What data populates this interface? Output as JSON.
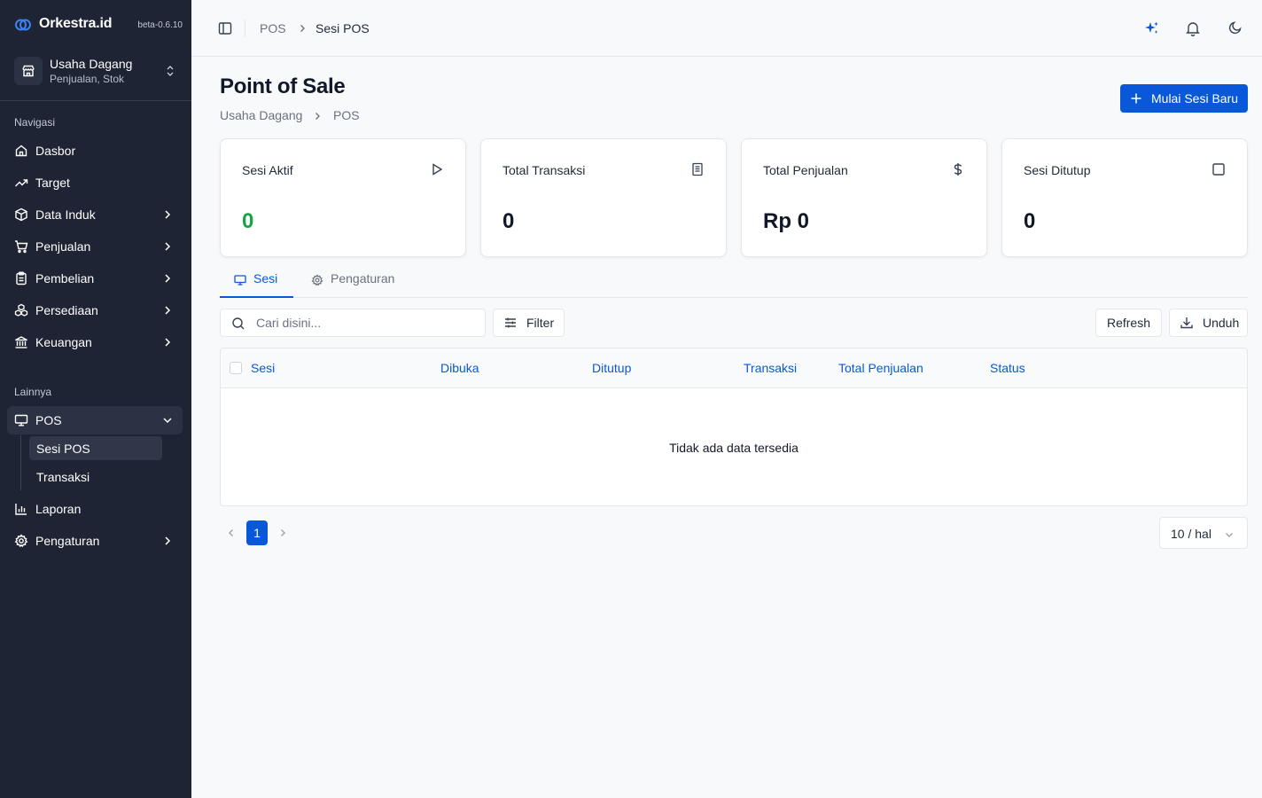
{
  "brand": {
    "name": "Orkestra.id",
    "version": "beta-0.6.10"
  },
  "org": {
    "name": "Usaha Dagang",
    "subtitle": "Penjualan, Stok"
  },
  "sidebar": {
    "section_main": "Navigasi",
    "section_other": "Lainnya",
    "items": [
      {
        "label": "Dasbor",
        "icon": "home-icon"
      },
      {
        "label": "Target",
        "icon": "trend-icon"
      },
      {
        "label": "Data Induk",
        "icon": "box-icon"
      },
      {
        "label": "Penjualan",
        "icon": "cart-icon"
      },
      {
        "label": "Pembelian",
        "icon": "clipboard-icon"
      },
      {
        "label": "Persediaan",
        "icon": "boxes-icon"
      },
      {
        "label": "Keuangan",
        "icon": "bank-icon"
      }
    ],
    "pos": {
      "label": "POS",
      "icon": "monitor-icon",
      "children": [
        "Sesi POS",
        "Transaksi"
      ]
    },
    "laporan": "Laporan",
    "pengaturan": "Pengaturan"
  },
  "topbar": {
    "crumbs": [
      "POS",
      "Sesi POS"
    ]
  },
  "header": {
    "title": "Point of Sale",
    "crumbs": [
      "Usaha Dagang",
      "POS"
    ],
    "primary_button": "Mulai Sesi Baru"
  },
  "stats": [
    {
      "label": "Sesi Aktif",
      "value": "0",
      "icon": "play-icon"
    },
    {
      "label": "Total Transaksi",
      "value": "0",
      "icon": "receipt-icon"
    },
    {
      "label": "Total Penjualan",
      "value": "Rp 0",
      "icon": "dollar-icon"
    },
    {
      "label": "Sesi Ditutup",
      "value": "0",
      "icon": "square-icon"
    }
  ],
  "tabs": [
    "Sesi",
    "Pengaturan"
  ],
  "toolbar": {
    "search_placeholder": "Cari disini...",
    "filter": "Filter",
    "refresh": "Refresh",
    "download": "Unduh"
  },
  "table": {
    "columns": [
      "Sesi",
      "Dibuka",
      "Ditutup",
      "Transaksi",
      "Total Penjualan",
      "Status"
    ],
    "empty": "Tidak ada data tersedia"
  },
  "pagination": {
    "current": "1",
    "page_size": "10 / hal"
  },
  "colors": {
    "sidebar_bg": "#1e2433",
    "accent": "#0958d9",
    "success": "#16a34a"
  }
}
